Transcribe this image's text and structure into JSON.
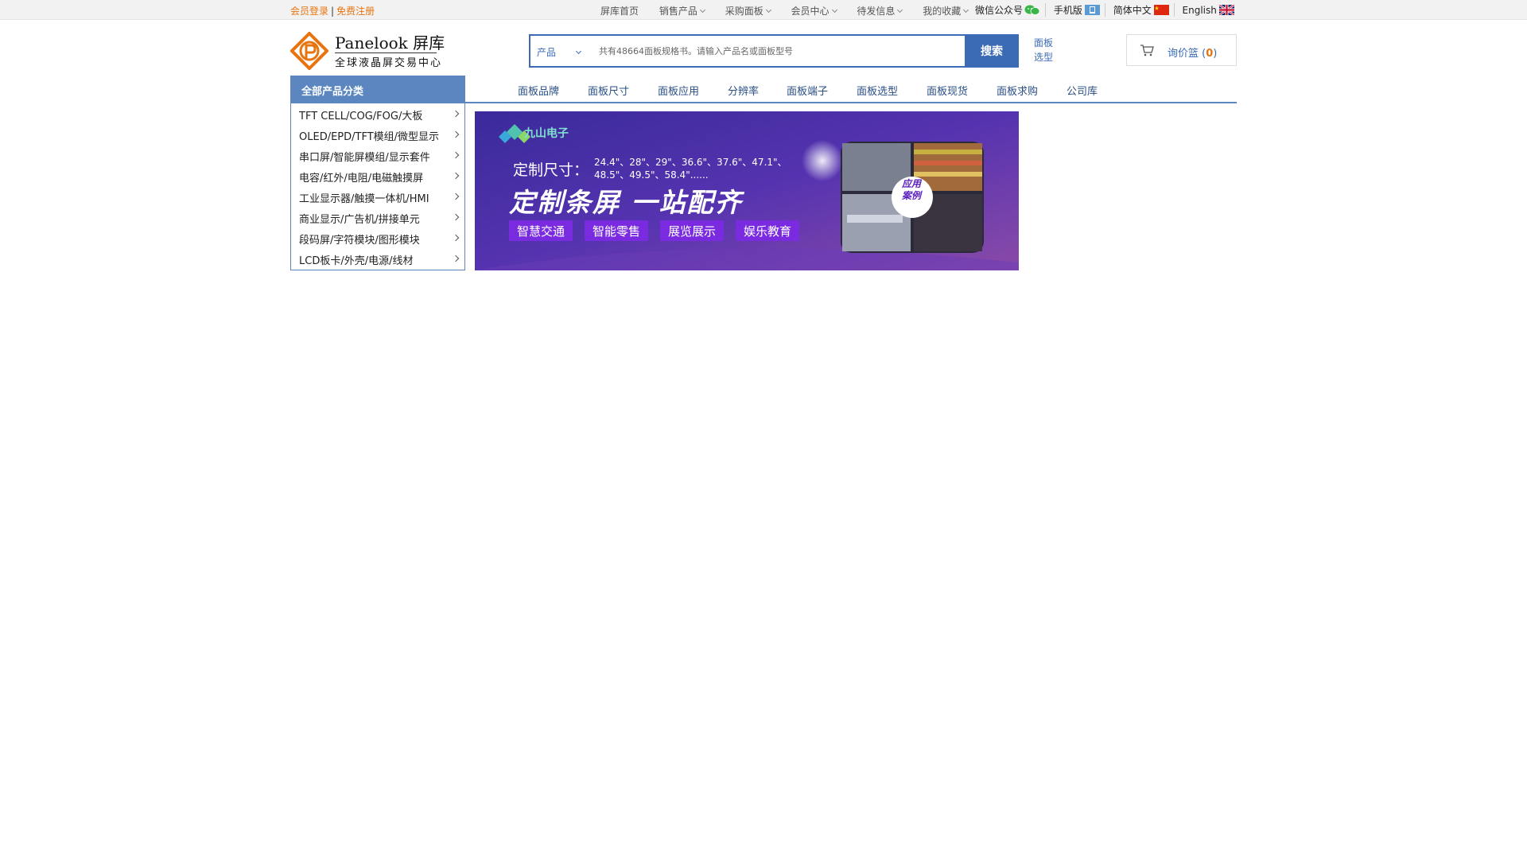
{
  "topbar": {
    "login": "会员登录",
    "separator": "|",
    "register": "免费注册",
    "nav": [
      "屏库首页",
      "销售产品",
      "采购面板",
      "会员中心",
      "待发信息",
      "我的收藏"
    ],
    "wechat": "微信公众号",
    "mobile": "手机版",
    "lang_cn": "简体中文",
    "lang_en": "English"
  },
  "logo": {
    "name": "Panelook 屏库",
    "slogan": "全球液晶屏交易中心"
  },
  "search": {
    "category": "产品",
    "placeholder": "共有48664面板规格书。请输入产品名或面板型号",
    "button": "搜索",
    "panel_select_line1": "面板",
    "panel_select_line2": "选型"
  },
  "cart": {
    "label": "询价篮",
    "open": "(",
    "count": "0",
    "close": ")"
  },
  "catbar": {
    "title": "全部产品分类"
  },
  "mainnav": [
    "面板品牌",
    "面板尺寸",
    "面板应用",
    "分辨率",
    "面板端子",
    "面板选型",
    "面板现货",
    "面板求购",
    "公司库"
  ],
  "categories": [
    "TFT CELL/COG/FOG/大板",
    "OLED/EPD/TFT模组/微型显示",
    "串口屏/智能屏模组/显示套件",
    "电容/红外/电阻/电磁触摸屏",
    "工业显示器/触摸一体机/HMI",
    "商业显示/广告机/拼接单元",
    "段码屏/字符模块/图形模块",
    "LCD板卡/外壳/电源/线材"
  ],
  "banner": {
    "brand": "九山电子",
    "size_label": "定制尺寸：",
    "size_values": "24.4\"、28\"、29\"、36.6\"、37.6\"、47.1\"、48.5\"、49.5\"、58.4\"......",
    "headline": "定制条屏  一站配齐",
    "tags": [
      "智慧交通",
      "智能零售",
      "展览展示",
      "娱乐教育"
    ],
    "case_line1": "应用",
    "case_line2": "案例"
  },
  "colors": {
    "accent_blue": "#3b6bb5",
    "nav_blue": "#5b86c0",
    "orange": "#e8740f",
    "banner_purple": "#4a2fa0"
  }
}
